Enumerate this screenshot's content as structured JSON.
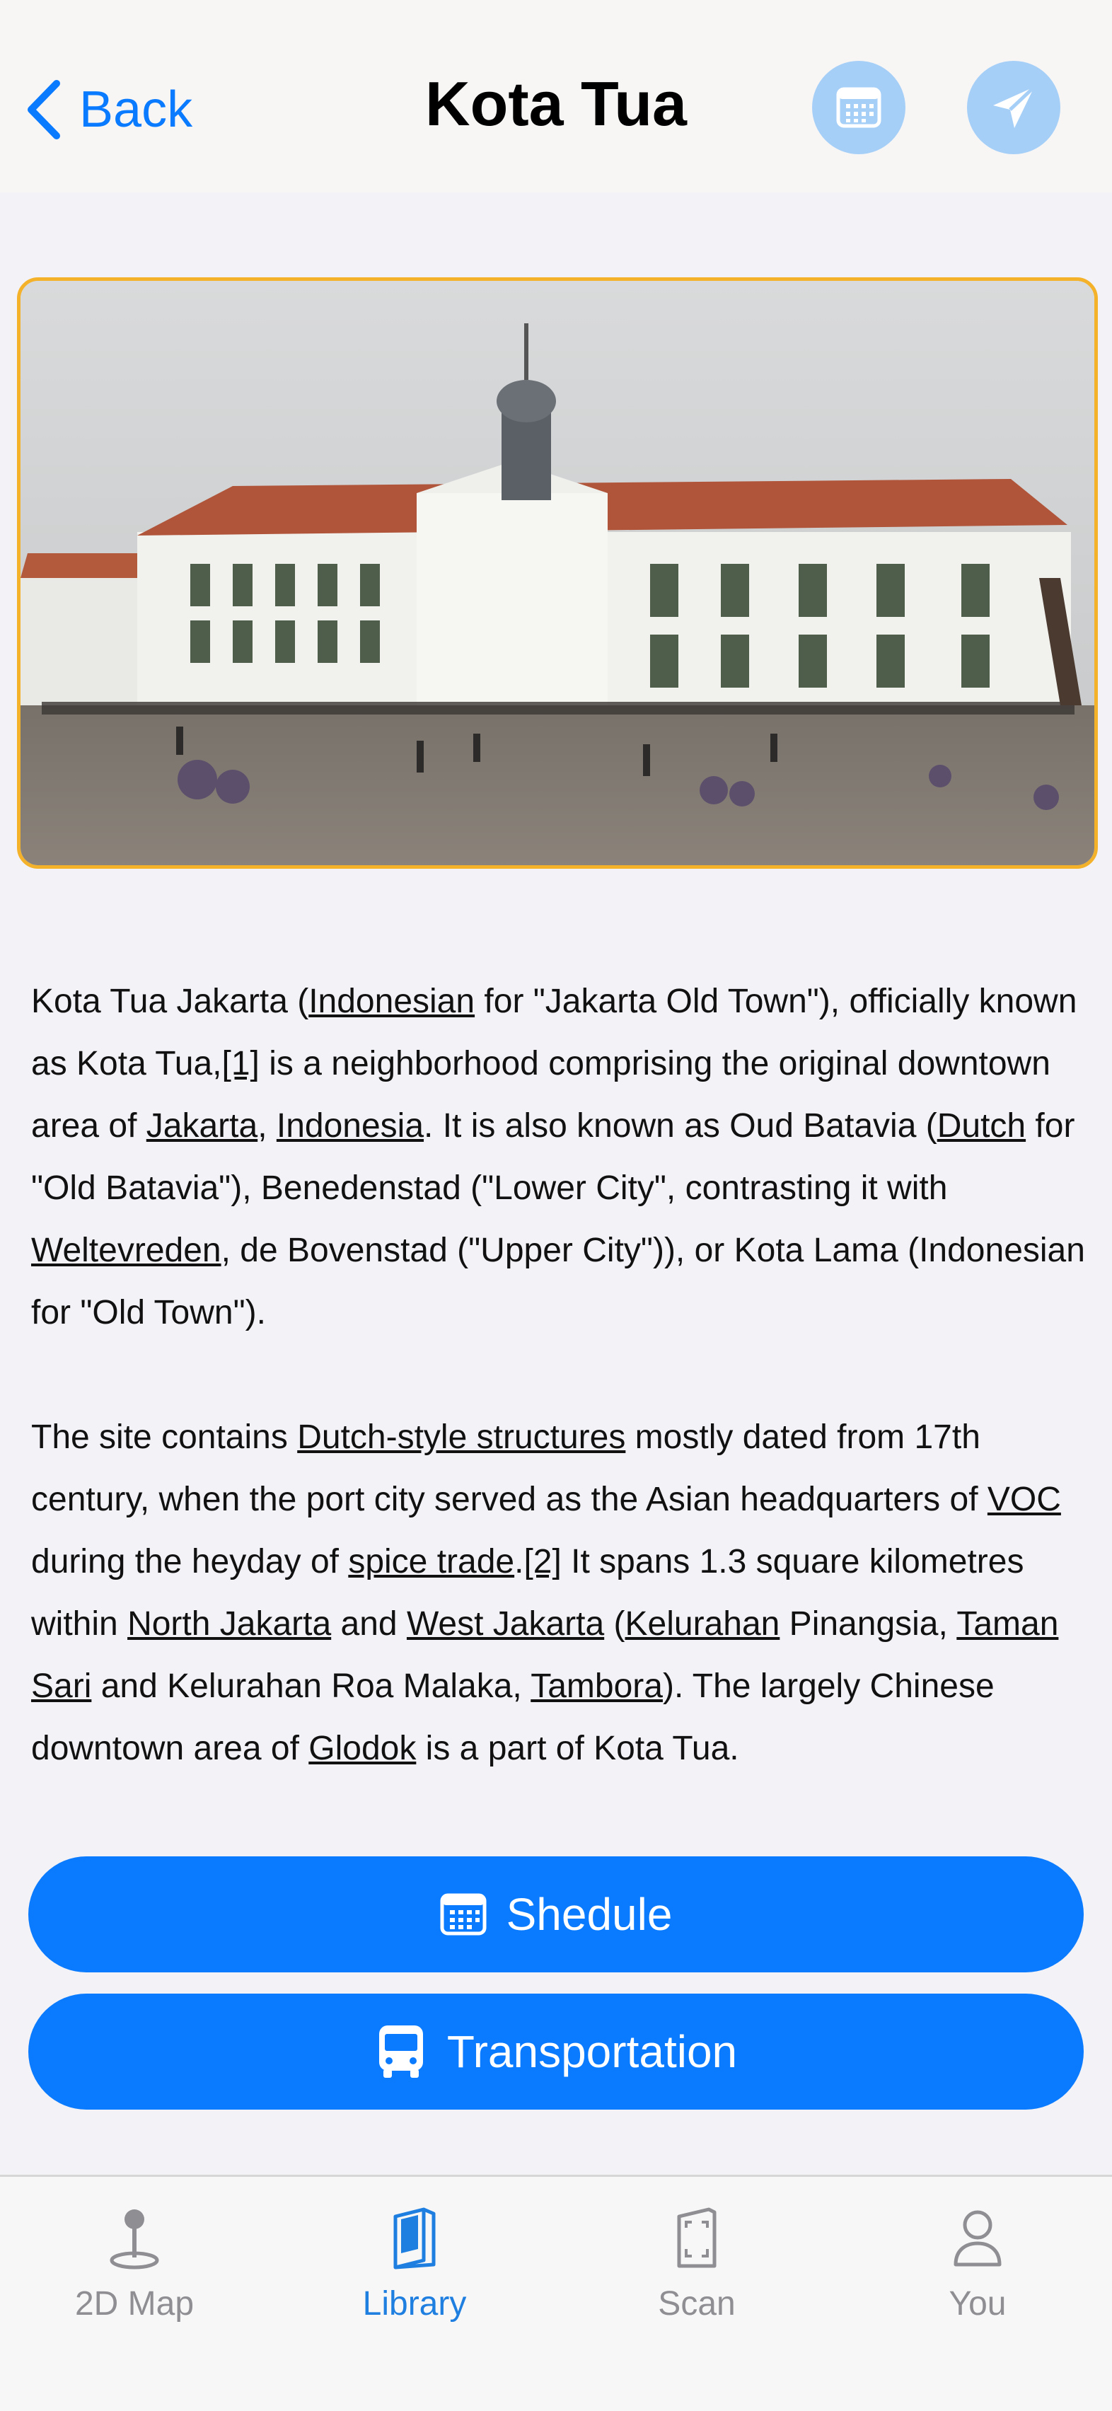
{
  "header": {
    "back_label": "Back",
    "title": "Kota Tua",
    "calendar_icon": "calendar-icon",
    "send_icon": "paper-plane-icon"
  },
  "hero": {
    "alt": "Kota Tua Jakarta history museum building with plaza full of visitors"
  },
  "article": {
    "p1": {
      "t1": "Kota Tua Jakarta (",
      "l1": "Indonesian",
      "t2": " for \"Jakarta Old Town\"), officially known as Kota Tua,",
      "l2": "[1]",
      "t3": " is a neighborhood comprising the original downtown area of ",
      "l3": "Jakarta",
      "t4": ", ",
      "l4": "Indonesia",
      "t5": ". It is also known as Oud Batavia (",
      "l5": "Dutch",
      "t6": " for \"Old Batavia\"), Benedenstad (\"Lower City\", contrasting it with ",
      "l6": "Weltevreden",
      "t7": ", de Bovenstad (\"Upper City\")), or Kota Lama (Indonesian for \"Old Town\")."
    },
    "p2": {
      "t1": "The site contains ",
      "l1": "Dutch-style structures",
      "t2": " mostly dated from 17th century, when the port city served as the Asian headquarters of ",
      "l2": "VOC",
      "t3": " during the heyday of ",
      "l3": "spice trade",
      "t4": ".",
      "l4": "[2]",
      "t5": " It spans 1.3 square kilometres within ",
      "l5": "North Jakarta",
      "t6": " and ",
      "l6": "West Jakarta",
      "t7": " (",
      "l7": "Kelurahan",
      "t8": " Pinangsia, ",
      "l8": "Taman Sari",
      "t9": " and Kelurahan Roa Malaka, ",
      "l9": "Tambora",
      "t10": "). The largely Chinese downtown area of ",
      "l10": "Glodok",
      "t11": " is a part of Kota Tua."
    }
  },
  "actions": {
    "schedule_label": "Shedule",
    "schedule_icon": "calendar-icon",
    "transport_label": "Transportation",
    "transport_icon": "bus-icon"
  },
  "tabs": [
    {
      "label": "2D Map",
      "icon": "map-pin-icon",
      "active": false
    },
    {
      "label": "Library",
      "icon": "book-icon",
      "active": true
    },
    {
      "label": "Scan",
      "icon": "scan-icon",
      "active": false
    },
    {
      "label": "You",
      "icon": "person-icon",
      "active": false
    }
  ],
  "colors": {
    "accent": "#0a7bff",
    "hero_border": "#f4b12a",
    "header_button_bg": "#a6cff8",
    "tab_inactive": "#8e8e93"
  }
}
